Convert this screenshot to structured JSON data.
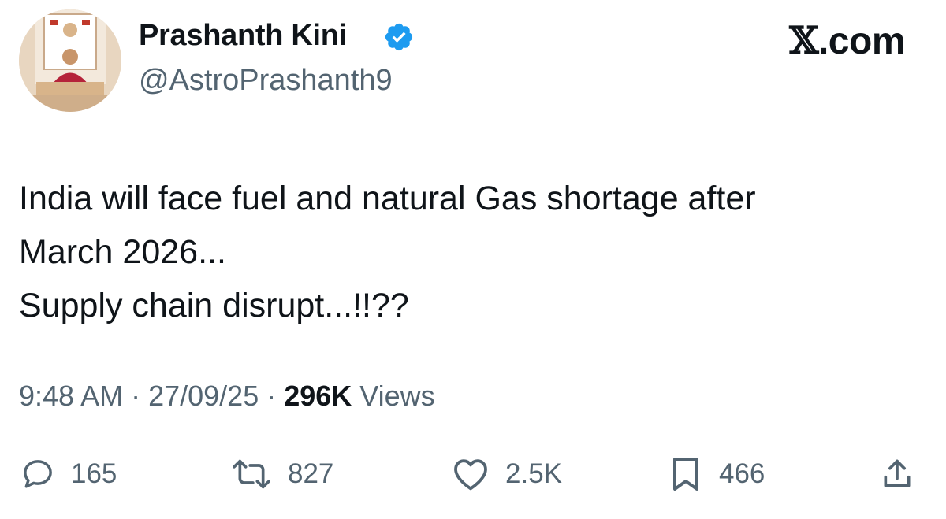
{
  "author": {
    "name": "Prashanth Kini",
    "handle": "@AstroPrashanth9",
    "verified": true
  },
  "brand": {
    "label": ".com",
    "icon": "x-logo"
  },
  "tweet": {
    "text": "India will face fuel and natural Gas shortage after\nMarch 2026...\nSupply chain disrupt...!!??"
  },
  "meta": {
    "time": "9:48 AM",
    "sep1": " · ",
    "date": "27/09/25",
    "sep2": " · ",
    "views_count": "296K",
    "views_label": " Views"
  },
  "actions": {
    "replies": "165",
    "reposts": "827",
    "likes": "2.5K",
    "bookmarks": "466"
  },
  "colors": {
    "text": "#0f1419",
    "secondary": "#536471",
    "verified": "#1d9bf0"
  }
}
